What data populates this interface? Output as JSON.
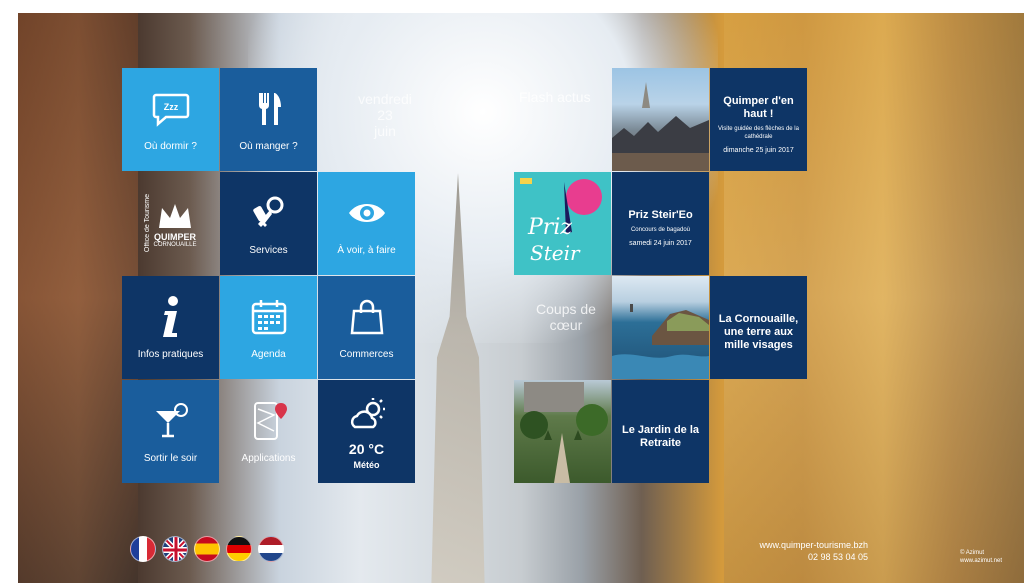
{
  "tiles": {
    "dormir": "Où dormir ?",
    "manger": "Où manger ?",
    "services": "Services",
    "voir": "À voir, à faire",
    "infos": "Infos pratiques",
    "agenda": "Agenda",
    "commerces": "Commerces",
    "sortir": "Sortir le soir",
    "applications": "Applications",
    "meteo_temp": "20 °C",
    "meteo_label": "Météo"
  },
  "logo": {
    "office": "Office de Tourisme",
    "city": "QUIMPER",
    "region": "CORNOUAILLE"
  },
  "date": {
    "weekday": "vendredi",
    "day": "23",
    "month": "juin"
  },
  "flash": {
    "heading": "Flash actus",
    "items": [
      {
        "title": "Quimper d'en haut !",
        "subtitle": "Visite guidée des flèches de la cathédrale",
        "date": "dimanche 25 juin 2017"
      },
      {
        "title": "Priz Steir'Eo",
        "subtitle": "Concours de bagadoù",
        "date": "samedi 24 juin 2017"
      }
    ]
  },
  "coups": {
    "heading": "Coups de cœur",
    "items": [
      {
        "title": "La Cornouaille, une terre aux mille visages"
      },
      {
        "title": "Le Jardin de la Retraite"
      }
    ]
  },
  "footer": {
    "website": "www.quimper-tourisme.bzh",
    "phone": "02 98 53 04 05",
    "credit_line1": "© Azimut",
    "credit_line2": "www.azimut.net"
  },
  "flags": [
    "french-flag",
    "uk-flag",
    "spanish-flag",
    "german-flag",
    "dutch-flag"
  ],
  "colors": {
    "light_blue": "#2da6e2",
    "mid_blue": "#1a5d9c",
    "dark_blue": "#0e3566"
  }
}
